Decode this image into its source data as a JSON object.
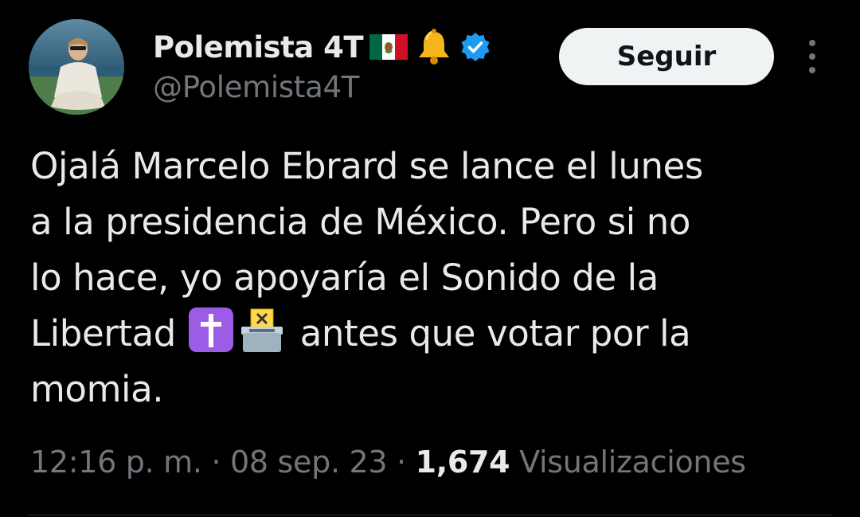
{
  "author": {
    "display_name": "Polemista 4T",
    "handle": "@Polemista4T",
    "badges": [
      "mexico-flag-emoji",
      "bell-emoji",
      "verified-badge-icon"
    ],
    "verified_color": "#1d9bf0"
  },
  "actions": {
    "follow_label": "Seguir",
    "more_icon": "more-vertical-icon"
  },
  "tweet": {
    "lines": [
      "Ojalá Marcelo Ebrard se lance el lunes",
      "a la presidencia de México. Pero si no",
      "lo hace, yo apoyaría el Sonido de la",
      "antes que votar por la",
      "momia."
    ],
    "line4_prefix": "Libertad",
    "inline_emojis": [
      "latin-cross-emoji",
      "ballot-box-emoji"
    ]
  },
  "meta": {
    "time": "12:16 p. m.",
    "separator": " · ",
    "date": "08 sep. 23",
    "views_count": "1,674",
    "views_label": "Visualizaciones"
  },
  "colors": {
    "background": "#000000",
    "primary_text": "#e7e9ea",
    "secondary_text": "#71767b",
    "button_bg": "#eff3f4"
  }
}
